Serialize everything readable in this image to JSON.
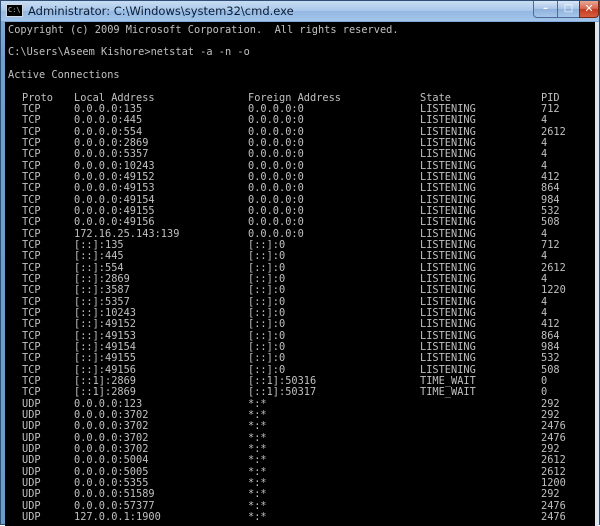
{
  "window": {
    "title": "Administrator: C:\\Windows\\system32\\cmd.exe",
    "icon_label": "C:\\",
    "buttons": {
      "minimize": "–",
      "maximize": "□",
      "close": "✕"
    }
  },
  "console": {
    "copyright": "Copyright (c) 2009 Microsoft Corporation.  All rights reserved.",
    "prompt": "C:\\Users\\Aseem Kishore>netstat -a -n -o",
    "section_title": "Active Connections",
    "headers": {
      "proto": "Proto",
      "local": "Local Address",
      "foreign": "Foreign Address",
      "state": "State",
      "pid": "PID"
    },
    "rows": [
      {
        "proto": "TCP",
        "local": "0.0.0.0:135",
        "foreign": "0.0.0.0:0",
        "state": "LISTENING",
        "pid": "712"
      },
      {
        "proto": "TCP",
        "local": "0.0.0.0:445",
        "foreign": "0.0.0.0:0",
        "state": "LISTENING",
        "pid": "4"
      },
      {
        "proto": "TCP",
        "local": "0.0.0.0:554",
        "foreign": "0.0.0.0:0",
        "state": "LISTENING",
        "pid": "2612"
      },
      {
        "proto": "TCP",
        "local": "0.0.0.0:2869",
        "foreign": "0.0.0.0:0",
        "state": "LISTENING",
        "pid": "4"
      },
      {
        "proto": "TCP",
        "local": "0.0.0.0:5357",
        "foreign": "0.0.0.0:0",
        "state": "LISTENING",
        "pid": "4"
      },
      {
        "proto": "TCP",
        "local": "0.0.0.0:10243",
        "foreign": "0.0.0.0:0",
        "state": "LISTENING",
        "pid": "4"
      },
      {
        "proto": "TCP",
        "local": "0.0.0.0:49152",
        "foreign": "0.0.0.0:0",
        "state": "LISTENING",
        "pid": "412"
      },
      {
        "proto": "TCP",
        "local": "0.0.0.0:49153",
        "foreign": "0.0.0.0:0",
        "state": "LISTENING",
        "pid": "864"
      },
      {
        "proto": "TCP",
        "local": "0.0.0.0:49154",
        "foreign": "0.0.0.0:0",
        "state": "LISTENING",
        "pid": "984"
      },
      {
        "proto": "TCP",
        "local": "0.0.0.0:49155",
        "foreign": "0.0.0.0:0",
        "state": "LISTENING",
        "pid": "532"
      },
      {
        "proto": "TCP",
        "local": "0.0.0.0:49156",
        "foreign": "0.0.0.0:0",
        "state": "LISTENING",
        "pid": "508"
      },
      {
        "proto": "TCP",
        "local": "172.16.25.143:139",
        "foreign": "0.0.0.0:0",
        "state": "LISTENING",
        "pid": "4"
      },
      {
        "proto": "TCP",
        "local": "[::]:135",
        "foreign": "[::]:0",
        "state": "LISTENING",
        "pid": "712"
      },
      {
        "proto": "TCP",
        "local": "[::]:445",
        "foreign": "[::]:0",
        "state": "LISTENING",
        "pid": "4"
      },
      {
        "proto": "TCP",
        "local": "[::]:554",
        "foreign": "[::]:0",
        "state": "LISTENING",
        "pid": "2612"
      },
      {
        "proto": "TCP",
        "local": "[::]:2869",
        "foreign": "[::]:0",
        "state": "LISTENING",
        "pid": "4"
      },
      {
        "proto": "TCP",
        "local": "[::]:3587",
        "foreign": "[::]:0",
        "state": "LISTENING",
        "pid": "1220"
      },
      {
        "proto": "TCP",
        "local": "[::]:5357",
        "foreign": "[::]:0",
        "state": "LISTENING",
        "pid": "4"
      },
      {
        "proto": "TCP",
        "local": "[::]:10243",
        "foreign": "[::]:0",
        "state": "LISTENING",
        "pid": "4"
      },
      {
        "proto": "TCP",
        "local": "[::]:49152",
        "foreign": "[::]:0",
        "state": "LISTENING",
        "pid": "412"
      },
      {
        "proto": "TCP",
        "local": "[::]:49153",
        "foreign": "[::]:0",
        "state": "LISTENING",
        "pid": "864"
      },
      {
        "proto": "TCP",
        "local": "[::]:49154",
        "foreign": "[::]:0",
        "state": "LISTENING",
        "pid": "984"
      },
      {
        "proto": "TCP",
        "local": "[::]:49155",
        "foreign": "[::]:0",
        "state": "LISTENING",
        "pid": "532"
      },
      {
        "proto": "TCP",
        "local": "[::]:49156",
        "foreign": "[::]:0",
        "state": "LISTENING",
        "pid": "508"
      },
      {
        "proto": "TCP",
        "local": "[::1]:2869",
        "foreign": "[::1]:50316",
        "state": "TIME_WAIT",
        "pid": "0"
      },
      {
        "proto": "TCP",
        "local": "[::1]:2869",
        "foreign": "[::1]:50317",
        "state": "TIME_WAIT",
        "pid": "0"
      },
      {
        "proto": "UDP",
        "local": "0.0.0.0:123",
        "foreign": "*:*",
        "state": "",
        "pid": "292"
      },
      {
        "proto": "UDP",
        "local": "0.0.0.0:3702",
        "foreign": "*:*",
        "state": "",
        "pid": "292"
      },
      {
        "proto": "UDP",
        "local": "0.0.0.0:3702",
        "foreign": "*:*",
        "state": "",
        "pid": "2476"
      },
      {
        "proto": "UDP",
        "local": "0.0.0.0:3702",
        "foreign": "*:*",
        "state": "",
        "pid": "2476"
      },
      {
        "proto": "UDP",
        "local": "0.0.0.0:3702",
        "foreign": "*:*",
        "state": "",
        "pid": "292"
      },
      {
        "proto": "UDP",
        "local": "0.0.0.0:5004",
        "foreign": "*:*",
        "state": "",
        "pid": "2612"
      },
      {
        "proto": "UDP",
        "local": "0.0.0.0:5005",
        "foreign": "*:*",
        "state": "",
        "pid": "2612"
      },
      {
        "proto": "UDP",
        "local": "0.0.0.0:5355",
        "foreign": "*:*",
        "state": "",
        "pid": "1200"
      },
      {
        "proto": "UDP",
        "local": "0.0.0.0:51589",
        "foreign": "*:*",
        "state": "",
        "pid": "292"
      },
      {
        "proto": "UDP",
        "local": "0.0.0.0:57377",
        "foreign": "*:*",
        "state": "",
        "pid": "2476"
      },
      {
        "proto": "UDP",
        "local": "127.0.0.1:1900",
        "foreign": "*:*",
        "state": "",
        "pid": "2476"
      }
    ]
  }
}
